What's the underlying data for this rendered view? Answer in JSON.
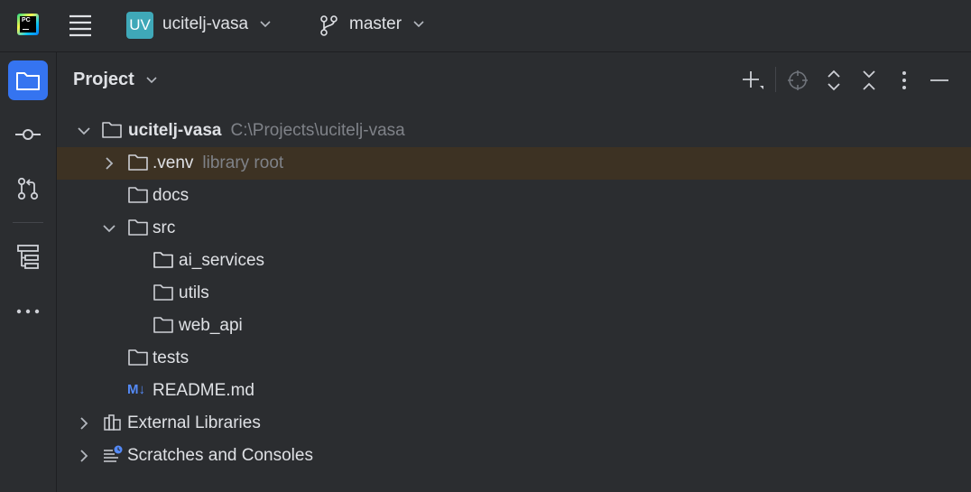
{
  "titlebar": {
    "app_logo_text": "PC",
    "project_badge": "UV",
    "project_name": "ucitelj-vasa",
    "branch": "master"
  },
  "toolstrip": {
    "items": [
      "project-icon",
      "commit-icon",
      "pull-requests-icon",
      "structure-icon",
      "more-icon"
    ],
    "active": "project-icon"
  },
  "panel": {
    "title": "Project"
  },
  "tree": {
    "root": {
      "name": "ucitelj-vasa",
      "path": "C:\\Projects\\ucitelj-vasa"
    },
    "venv": {
      "name": ".venv",
      "hint": "library root"
    },
    "docs": "docs",
    "src": "src",
    "ai_services": "ai_services",
    "utils": "utils",
    "web_api": "web_api",
    "tests": "tests",
    "readme": {
      "name": "README.md",
      "icon_text": "M↓"
    },
    "external_libraries": "External Libraries",
    "scratches": "Scratches and Consoles"
  },
  "colors": {
    "accent": "#3574f0",
    "selection": "#2e436e",
    "excluded_row": "#3d3223",
    "project_badge": "#3fa8b8",
    "markdown_icon": "#548af7"
  }
}
